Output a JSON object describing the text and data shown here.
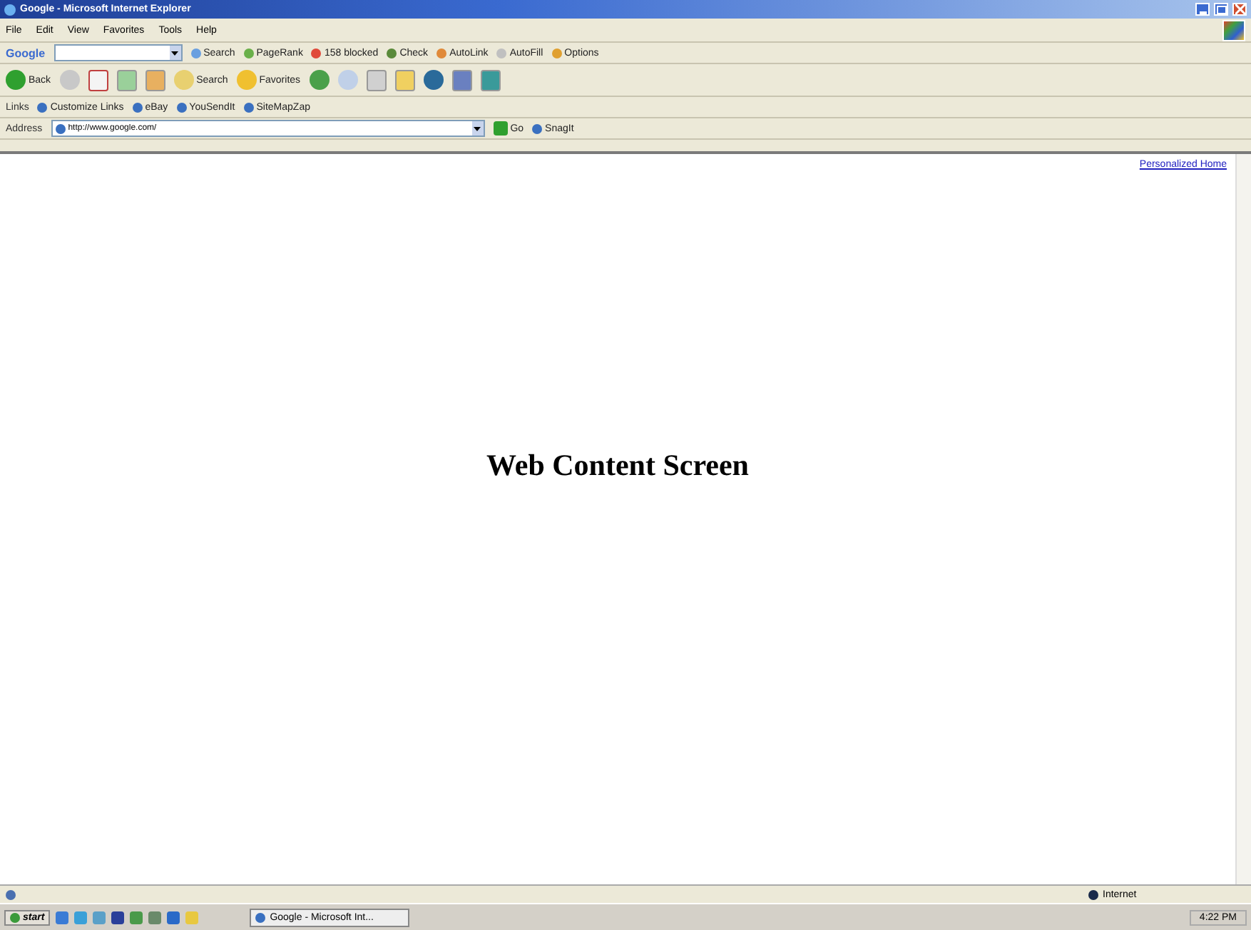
{
  "window": {
    "title": "Google - Microsoft Internet Explorer"
  },
  "menu": [
    "File",
    "Edit",
    "View",
    "Favorites",
    "Tools",
    "Help"
  ],
  "google_toolbar": {
    "logo": "Google",
    "search_button": "Search",
    "items": [
      "PageRank",
      "158 blocked",
      "Check",
      "AutoLink",
      "AutoFill",
      "Options"
    ]
  },
  "nav_toolbar": {
    "back": "Back",
    "search": "Search",
    "favorites": "Favorites"
  },
  "links_bar": {
    "label": "Links",
    "links": [
      "Customize Links",
      "eBay",
      "YouSendIt",
      "SiteMapZap"
    ]
  },
  "address_bar": {
    "label": "Address",
    "value": "http://www.google.com/",
    "go": "Go",
    "snagit": "SnagIt"
  },
  "content": {
    "link": "Personalized Home",
    "heading": "Web Content Screen"
  },
  "status_bar": {
    "zone": "Internet"
  },
  "taskbar": {
    "start": "start",
    "window_button": "Google - Microsoft Int...",
    "clock": "4:22 PM"
  }
}
